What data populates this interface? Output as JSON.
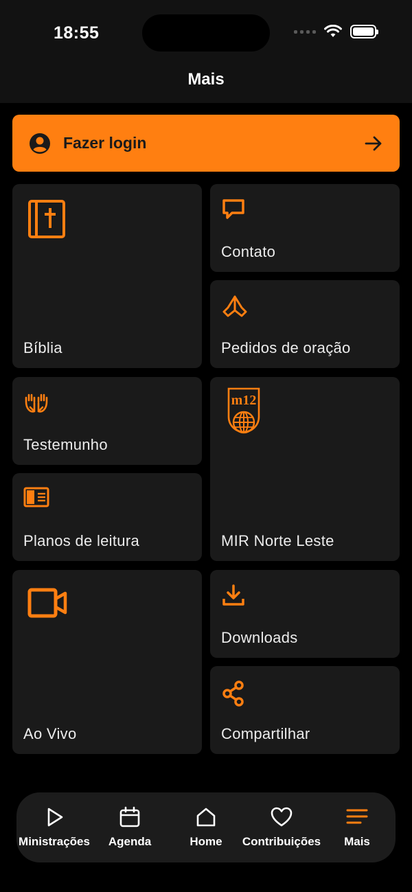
{
  "status_bar": {
    "time": "18:55"
  },
  "header": {
    "title": "Mais"
  },
  "login": {
    "label": "Fazer login"
  },
  "tiles": {
    "biblia": "Bíblia",
    "contato": "Contato",
    "pedidos": "Pedidos de oração",
    "testemunho": "Testemunho",
    "mir": "MIR Norte Leste",
    "planos": "Planos de leitura",
    "aovivo": "Ao Vivo",
    "downloads": "Downloads",
    "compartilhar": "Compartilhar",
    "mir_logo_text": "m12"
  },
  "tabbar": {
    "items": [
      {
        "label": "Ministrações",
        "icon": "play-icon"
      },
      {
        "label": "Agenda",
        "icon": "calendar-icon"
      },
      {
        "label": "Home",
        "icon": "home-icon"
      },
      {
        "label": "Contribuições",
        "icon": "heart-icon"
      },
      {
        "label": "Mais",
        "icon": "menu-icon",
        "active": true
      }
    ]
  },
  "colors": {
    "accent": "#ff7f11",
    "background": "#000000",
    "tile": "#1a1a1a",
    "header": "#121212"
  }
}
